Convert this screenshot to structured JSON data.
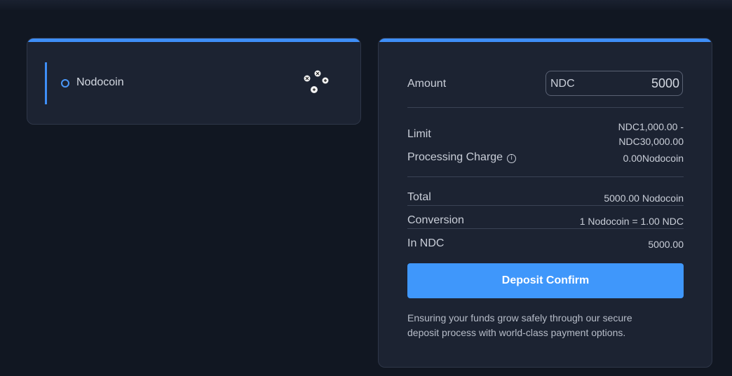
{
  "payment_methods": {
    "items": [
      {
        "label": "Nodocoin",
        "selected": true,
        "icon": "nodocoin-logo"
      }
    ]
  },
  "summary": {
    "amount_label": "Amount",
    "amount_currency": "NDC",
    "amount_value": "5000",
    "limit_label": "Limit",
    "limit_value_line1": "NDC1,000.00 -",
    "limit_value_line2": "NDC30,000.00",
    "charge_label": "Processing Charge",
    "charge_icon": "info-icon",
    "charge_value": "0.00Nodocoin",
    "total_label": "Total",
    "total_value": "5000.00 Nodocoin",
    "conversion_label": "Conversion",
    "conversion_value": "1 Nodocoin = 1.00 NDC",
    "in_ndc_label": "In NDC",
    "in_ndc_value": "5000.00",
    "confirm_label": "Deposit Confirm",
    "note": "Ensuring your funds grow safely through our secure deposit process with world-class payment options."
  },
  "colors": {
    "accent": "#3e8ef7",
    "button": "#3f97fb",
    "background": "#111722",
    "card": "#1c2332"
  }
}
